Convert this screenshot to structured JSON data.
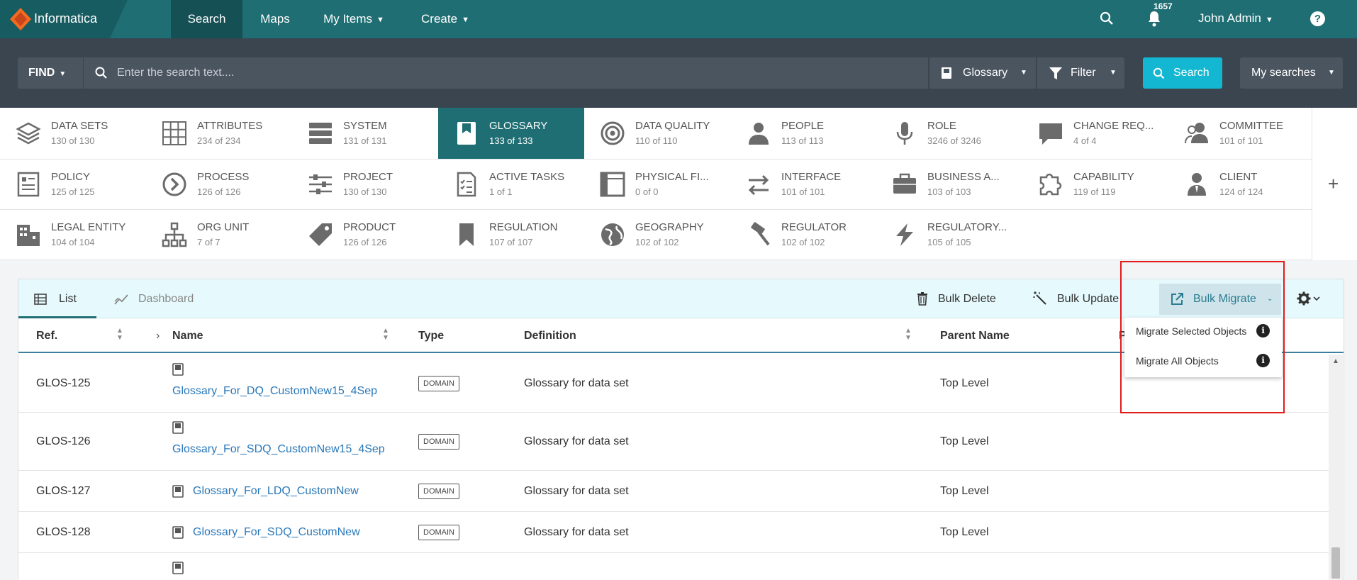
{
  "app": {
    "brand": "Informatica"
  },
  "nav": {
    "search": "Search",
    "maps": "Maps",
    "my_items": "My Items",
    "create": "Create",
    "notifications_count": "1657",
    "user": "John Admin",
    "help": "?"
  },
  "searchbar": {
    "find": "FIND",
    "placeholder": "Enter the search text....",
    "scope": "Glossary",
    "filter": "Filter",
    "search": "Search",
    "my_searches": "My searches"
  },
  "categories": [
    {
      "label": "DATA SETS",
      "count": "130 of 130",
      "icon": "layers-icon"
    },
    {
      "label": "ATTRIBUTES",
      "count": "234 of 234",
      "icon": "grid-icon"
    },
    {
      "label": "SYSTEM",
      "count": "131 of 131",
      "icon": "server-icon"
    },
    {
      "label": "GLOSSARY",
      "count": "133 of 133",
      "icon": "book-icon",
      "active": true
    },
    {
      "label": "DATA QUALITY",
      "count": "110 of 110",
      "icon": "target-icon"
    },
    {
      "label": "PEOPLE",
      "count": "113 of 113",
      "icon": "person-icon"
    },
    {
      "label": "ROLE",
      "count": "3246 of 3246",
      "icon": "microphone-icon"
    },
    {
      "label": "CHANGE REQ...",
      "count": "4 of 4",
      "icon": "chat-icon"
    },
    {
      "label": "COMMITTEE",
      "count": "101 of 101",
      "icon": "group-icon"
    },
    {
      "label": "POLICY",
      "count": "125 of 125",
      "icon": "document-icon"
    },
    {
      "label": "PROCESS",
      "count": "126 of 126",
      "icon": "chevron-circle-icon"
    },
    {
      "label": "PROJECT",
      "count": "130 of 130",
      "icon": "sliders-icon"
    },
    {
      "label": "ACTIVE TASKS",
      "count": "1 of 1",
      "icon": "checklist-icon"
    },
    {
      "label": "PHYSICAL FI...",
      "count": "0 of 0",
      "icon": "film-icon"
    },
    {
      "label": "INTERFACE",
      "count": "101 of 101",
      "icon": "exchange-icon"
    },
    {
      "label": "BUSINESS A...",
      "count": "103 of 103",
      "icon": "briefcase-icon"
    },
    {
      "label": "CAPABILITY",
      "count": "119 of 119",
      "icon": "puzzle-icon"
    },
    {
      "label": "CLIENT",
      "count": "124 of 124",
      "icon": "client-icon"
    },
    {
      "label": "LEGAL ENTITY",
      "count": "104 of 104",
      "icon": "building-icon"
    },
    {
      "label": "ORG UNIT",
      "count": "7 of 7",
      "icon": "org-chart-icon"
    },
    {
      "label": "PRODUCT",
      "count": "126 of 126",
      "icon": "tag-icon"
    },
    {
      "label": "REGULATION",
      "count": "107 of 107",
      "icon": "bookmark-icon"
    },
    {
      "label": "GEOGRAPHY",
      "count": "102 of 102",
      "icon": "globe-icon"
    },
    {
      "label": "REGULATOR",
      "count": "102 of 102",
      "icon": "gavel-icon"
    },
    {
      "label": "REGULATORY...",
      "count": "105 of 105",
      "icon": "bolt-icon"
    }
  ],
  "plus": "+",
  "tabs": {
    "list": "List",
    "dashboard": "Dashboard"
  },
  "toolbar": {
    "bulk_delete": "Bulk Delete",
    "bulk_update": "Bulk Update",
    "bulk_migrate": "Bulk Migrate"
  },
  "columns": {
    "ref": "Ref.",
    "name": "Name",
    "type": "Type",
    "definition": "Definition",
    "parent": "Parent Name",
    "extra": "P"
  },
  "rows": [
    {
      "ref": "GLOS-125",
      "name": "Glossary_For_DQ_CustomNew15_4Sep",
      "type": "DOMAIN",
      "definition": "Glossary for data set",
      "parent": "Top Level"
    },
    {
      "ref": "GLOS-126",
      "name": "Glossary_For_SDQ_CustomNew15_4Sep",
      "type": "DOMAIN",
      "definition": "Glossary for data set",
      "parent": "Top Level"
    },
    {
      "ref": "GLOS-127",
      "name": "Glossary_For_LDQ_CustomNew",
      "type": "DOMAIN",
      "definition": "Glossary for data set",
      "parent": "Top Level"
    },
    {
      "ref": "GLOS-128",
      "name": "Glossary_For_SDQ_CustomNew",
      "type": "DOMAIN",
      "definition": "Glossary for data set",
      "parent": "Top Level"
    }
  ],
  "migrate_menu": {
    "selected": "Migrate Selected Objects",
    "all": "Migrate All Objects",
    "info": "i"
  },
  "colors": {
    "nav": "#1f6e73",
    "accent": "#13b7d1",
    "link": "#2a78b8",
    "highlight": "#e21b1b"
  }
}
